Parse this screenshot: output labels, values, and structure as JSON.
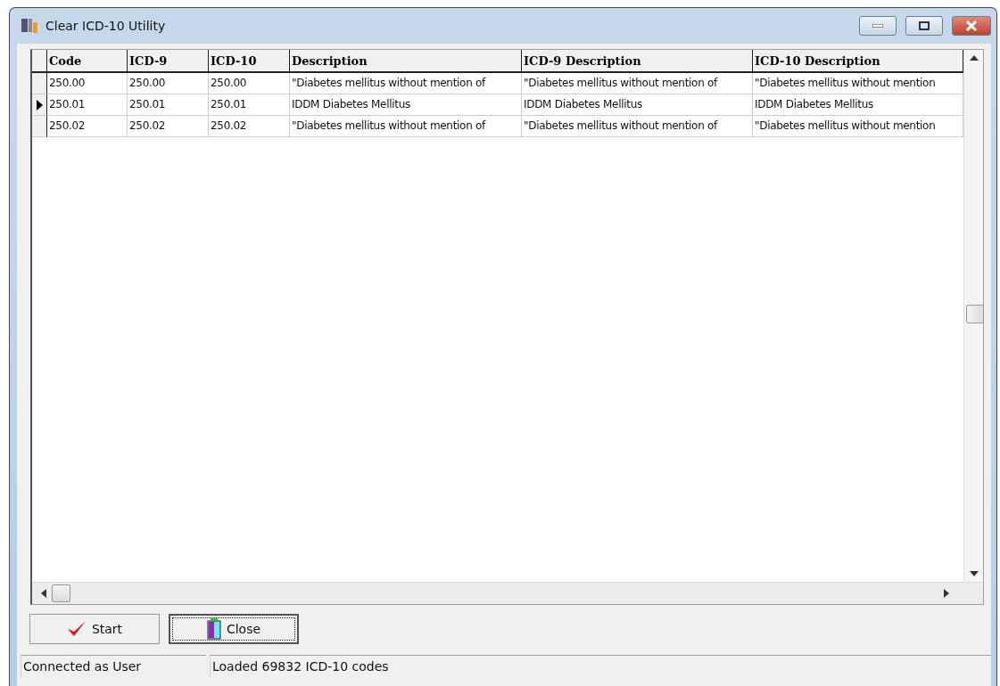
{
  "window": {
    "title": "Clear ICD-10 Utility"
  },
  "table": {
    "columns": [
      "Code",
      "ICD-9",
      "ICD-10",
      "Description",
      "ICD-9 Description",
      "ICD-10 Description"
    ],
    "rows": [
      {
        "selected": false,
        "cells": [
          "250.00",
          "250.00",
          "250.00",
          "\"Diabetes mellitus without mention of",
          "\"Diabetes mellitus without mention of",
          "\"Diabetes mellitus without mention"
        ]
      },
      {
        "selected": true,
        "cells": [
          "250.01",
          "250.01",
          "250.01",
          "IDDM Diabetes Mellitus",
          "IDDM Diabetes Mellitus",
          "IDDM Diabetes Mellitus"
        ]
      },
      {
        "selected": false,
        "cells": [
          "250.02",
          "250.02",
          "250.02",
          "\"Diabetes mellitus without mention of",
          "\"Diabetes mellitus without mention of",
          "\"Diabetes mellitus without mention"
        ]
      }
    ]
  },
  "buttons": [
    {
      "kind": "start",
      "label": "Start",
      "focused": false
    },
    {
      "kind": "close",
      "label": "Close",
      "focused": true
    }
  ],
  "status_bar": [
    "Connected as User",
    "Loaded 69832 ICD-10 codes"
  ]
}
